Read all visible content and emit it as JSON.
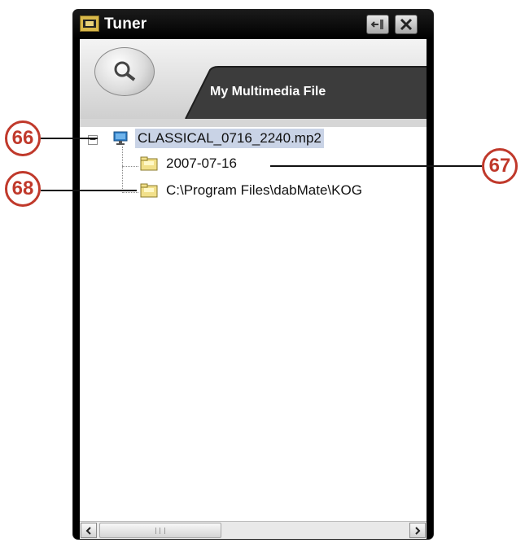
{
  "window": {
    "title": "Tuner"
  },
  "header": {
    "tab_label": "My Multimedia File"
  },
  "tree": {
    "root": {
      "label": "CLASSICAL_0716_2240.mp2",
      "expander_glyph": "−"
    },
    "children": [
      {
        "label": "2007-07-16"
      },
      {
        "label": "C:\\Program Files\\dabMate\\KOG"
      }
    ]
  },
  "callouts": {
    "root": "66",
    "date": "67",
    "path": "68"
  },
  "scrollbar": {
    "grip": "III"
  },
  "icons": {
    "app": "tuner-app-icon",
    "dock": "dock-icon",
    "close": "close-icon",
    "search": "search-icon",
    "root_node": "monitor-icon",
    "child_node": "folder-icon"
  },
  "colors": {
    "callout": "#c0392b",
    "selection": "#c9d3e6",
    "folder": "#f2e08a"
  }
}
